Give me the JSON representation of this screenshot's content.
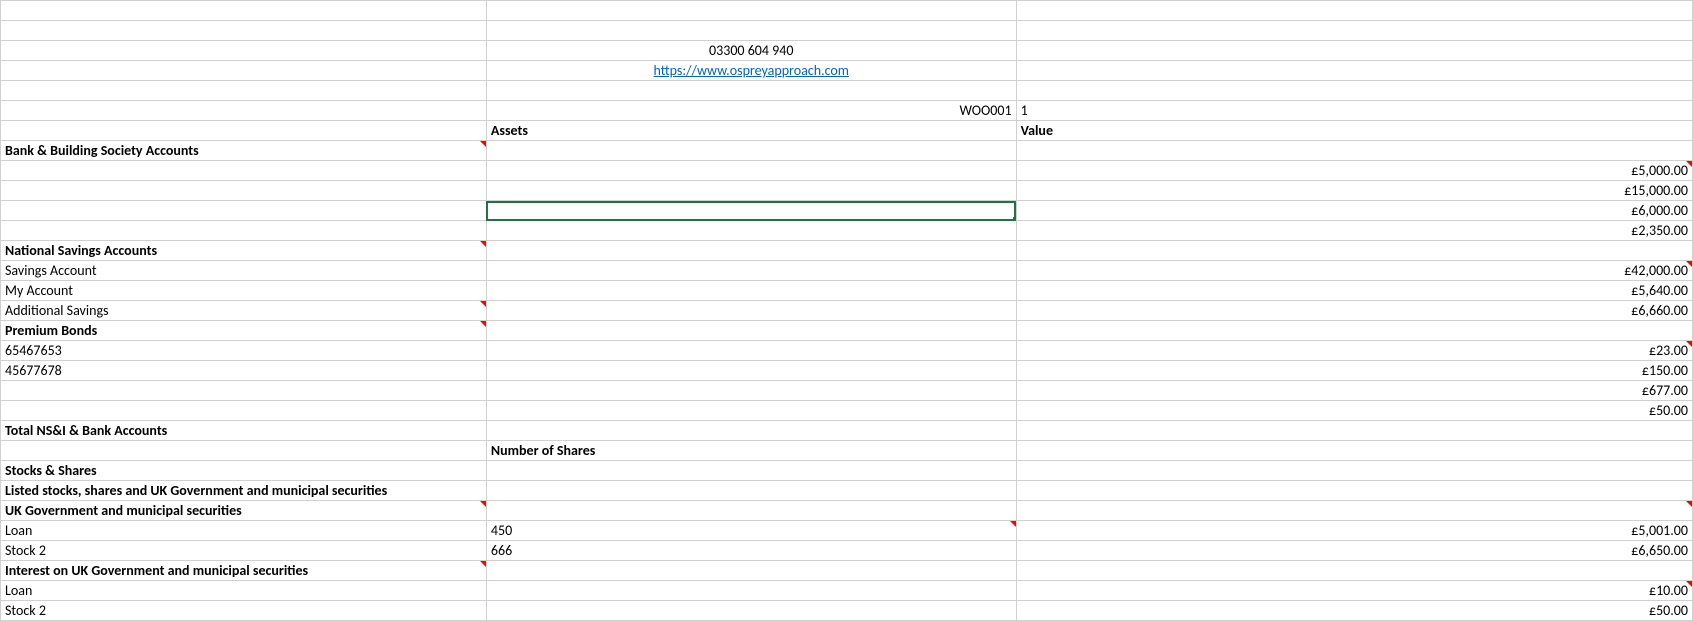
{
  "header": {
    "phone": "03300 604 940",
    "url": "https://www.ospreyapproach.com",
    "ref_b": "WOO001",
    "ref_c": "1"
  },
  "col_headers": {
    "b": "Assets",
    "c": "Value"
  },
  "sections": {
    "bank_building": "Bank & Building Society Accounts",
    "national_savings": "National Savings Accounts",
    "premium_bonds": "Premium Bonds",
    "total_nsi": "Total NS&I & Bank Accounts",
    "number_shares": "Number of Shares",
    "stocks_shares": "Stocks & Shares",
    "listed": "Listed stocks, shares and UK Government and municipal securities",
    "uk_gov": "UK Government and municipal securities",
    "interest_uk": "Interest on UK Government and municipal securities"
  },
  "bank_values": {
    "v1": "£5,000.00",
    "v2": "£15,000.00",
    "v3": "£6,000.00",
    "v4": "£2,350.00"
  },
  "nsa": {
    "r1": {
      "label": "Savings Account",
      "value": "£42,000.00"
    },
    "r2": {
      "label": "My Account",
      "value": "£5,640.00"
    },
    "r3": {
      "label": "Additional Savings",
      "value": "£6,660.00"
    }
  },
  "bonds": {
    "r1": {
      "label": "65467653",
      "value": "£23.00"
    },
    "r2": {
      "label": "45677678",
      "value": "£150.00"
    },
    "r3": {
      "value": "£677.00"
    },
    "r4": {
      "value": "£50.00"
    }
  },
  "uk_gov": {
    "r1": {
      "label": "Loan",
      "shares": "450",
      "value": "£5,001.00"
    },
    "r2": {
      "label": "Stock 2",
      "shares": "666",
      "value": "£6,650.00"
    }
  },
  "interest": {
    "r1": {
      "label": "Loan",
      "value": "£10.00"
    },
    "r2": {
      "label": "Stock 2",
      "value": "£50.00"
    }
  }
}
